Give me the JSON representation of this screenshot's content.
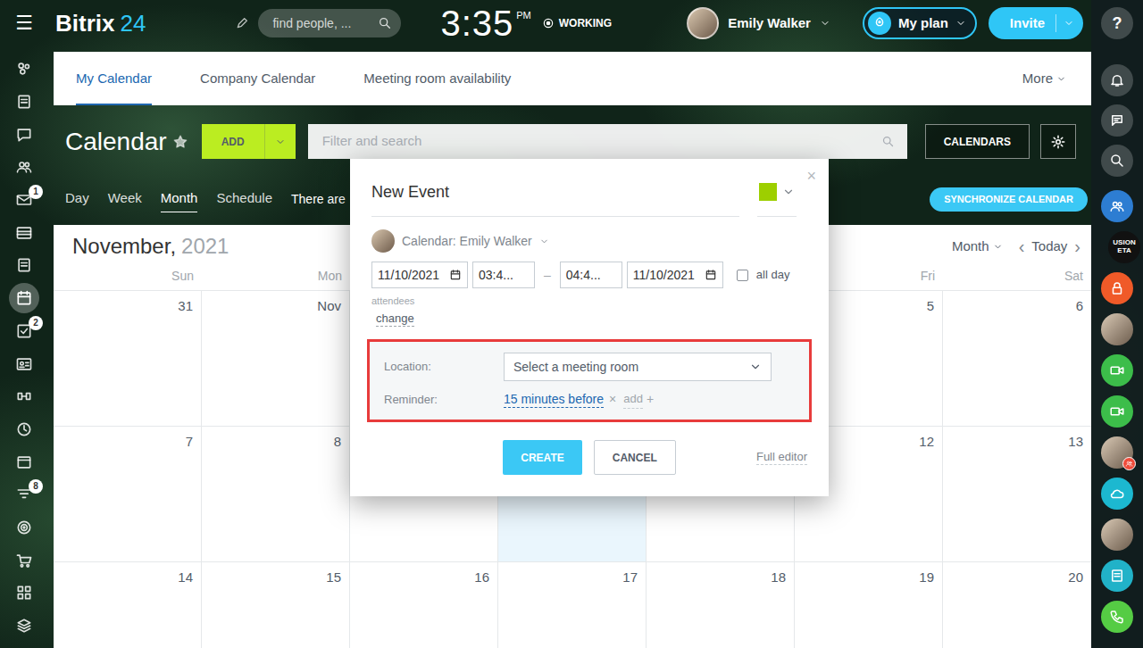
{
  "header": {
    "menu_icon": "☰",
    "logo": {
      "name": "Bitrix",
      "number": "24"
    },
    "search": {
      "placeholder": "find people, ..."
    },
    "clock": {
      "time": "3:35",
      "period": "PM"
    },
    "work_status": "WORKING",
    "user": {
      "name": "Emily Walker"
    },
    "plan_button": "My plan",
    "invite_button": "Invite"
  },
  "left_rail": {
    "items": [
      {
        "selected": false
      },
      {
        "selected": false
      },
      {
        "selected": false
      },
      {
        "selected": false
      },
      {
        "selected": false,
        "badge": "1"
      },
      {
        "selected": false
      },
      {
        "selected": false
      },
      {
        "selected": true
      },
      {
        "selected": false,
        "badge": "2"
      },
      {
        "selected": false
      },
      {
        "selected": false
      },
      {
        "selected": false
      },
      {
        "selected": false
      },
      {
        "selected": false,
        "badge": "8"
      },
      {
        "selected": false
      },
      {
        "selected": false
      },
      {
        "selected": false
      },
      {
        "selected": false
      }
    ]
  },
  "tabs": [
    {
      "label": "My Calendar",
      "selected": true
    },
    {
      "label": "Company Calendar",
      "selected": false
    },
    {
      "label": "Meeting room availability",
      "selected": false
    }
  ],
  "more_menu": "More",
  "toolbar": {
    "title": "Calendar",
    "add_button": "ADD",
    "filter": {
      "placeholder": "Filter and search"
    },
    "calendars_button": "CALENDARS"
  },
  "views": [
    {
      "label": "Day",
      "selected": false
    },
    {
      "label": "Week",
      "selected": false
    },
    {
      "label": "Month",
      "selected": true
    },
    {
      "label": "Schedule",
      "selected": false
    }
  ],
  "notice": "There are",
  "sync_button": "SYNCHRONIZE CALENDAR",
  "calendar": {
    "month": "November,",
    "year": "2021",
    "view_select": "Month",
    "prev": "‹",
    "today_button": "Today",
    "next": "›",
    "weekdays": [
      "Sun",
      "Mon",
      null,
      null,
      null,
      "Fri",
      "Sat"
    ],
    "weeks": [
      [
        {
          "date": "31",
          "today": false
        },
        {
          "date": "Nov",
          "today": false
        },
        {
          "today": false
        },
        {
          "today": false
        },
        {
          "today": false
        },
        {
          "date": "5",
          "today": false
        },
        {
          "date": "6",
          "today": false
        }
      ],
      [
        {
          "date": "7",
          "today": false
        },
        {
          "date": "8",
          "today": false
        },
        {
          "today": false
        },
        {
          "today": true
        },
        {
          "today": false
        },
        {
          "date": "12",
          "today": false
        },
        {
          "date": "13",
          "today": false
        }
      ],
      [
        {
          "date": "14",
          "today": false
        },
        {
          "date": "15",
          "today": false
        },
        {
          "date": "16",
          "today": false
        },
        {
          "date": "17",
          "today": false
        },
        {
          "date": "18",
          "today": false
        },
        {
          "date": "19",
          "today": false
        },
        {
          "date": "20",
          "today": false
        }
      ]
    ]
  },
  "new_event": {
    "title": "New Event",
    "color": "#9dcf00",
    "close": "×",
    "calendar": "Calendar: Emily Walker",
    "start_date": "11/10/2021",
    "start_time": "03:4...",
    "separator": "–",
    "end_time": "04:4...",
    "end_date": "11/10/2021",
    "all_day": {
      "label": "all day",
      "checked": false
    },
    "attendees": {
      "label": "attendees",
      "action": "change"
    },
    "location": {
      "label": "Location:",
      "placeholder": "Select a meeting room"
    },
    "reminder": {
      "label": "Reminder:",
      "value": "15 minutes before",
      "remove": "×",
      "add": "add",
      "add_icon": "+"
    },
    "create_button": "CREATE",
    "cancel_button": "CANCEL",
    "full_editor": "Full editor"
  },
  "right_rail": {
    "items": [
      {
        "kind": "tool",
        "label": "?",
        "alert": false
      },
      {
        "kind": "tool",
        "alert": false
      },
      {
        "kind": "tool",
        "alert": false
      },
      {
        "kind": "tool",
        "alert": false
      },
      {
        "kind": "app",
        "color": "#2d7dd2",
        "alert": false
      },
      {
        "kind": "logo",
        "lines": [
          "USION",
          "ETA"
        ],
        "alert": false
      },
      {
        "kind": "app",
        "color": "#f05a28",
        "alert": false
      },
      {
        "kind": "avatar",
        "alert": false
      },
      {
        "kind": "app",
        "color": "#3cbd4a",
        "alert": false
      },
      {
        "kind": "app",
        "color": "#3cbd4a",
        "alert": false
      },
      {
        "kind": "avatar",
        "alert": true
      },
      {
        "kind": "app",
        "color": "#1cb8d0",
        "alert": false
      },
      {
        "kind": "avatar",
        "alert": false
      },
      {
        "kind": "app",
        "color": "#21b2c8",
        "alert": false
      },
      {
        "kind": "app",
        "color": "#55cc44",
        "alert": false
      }
    ]
  }
}
